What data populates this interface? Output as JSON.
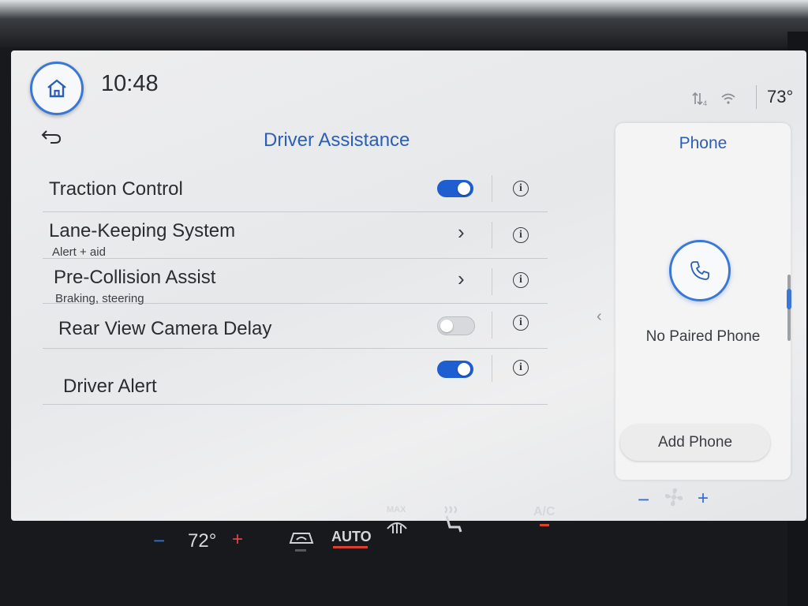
{
  "status_bar": {
    "time": "10:48",
    "outside_temp": "73°",
    "icons": [
      "home-icon",
      "data-signal-icon",
      "wifi-icon"
    ]
  },
  "settings": {
    "title": "Driver Assistance",
    "items": [
      {
        "label": "Traction Control",
        "sublabel": "",
        "control": "toggle",
        "on": true
      },
      {
        "label": "Lane-Keeping System",
        "sublabel": "Alert + aid",
        "control": "chevron",
        "chevron": "›"
      },
      {
        "label": "Pre-Collision Assist",
        "sublabel": "Braking, steering",
        "control": "chevron",
        "chevron": "›"
      },
      {
        "label": "Rear View Camera Delay",
        "sublabel": "",
        "control": "toggle",
        "on": false
      },
      {
        "label": "Driver Alert",
        "sublabel": "",
        "control": "toggle",
        "on": true
      }
    ],
    "info_glyph": "i"
  },
  "phone_panel": {
    "title": "Phone",
    "status": "No Paired Phone",
    "add_button": "Add Phone"
  },
  "climate": {
    "minus": "−",
    "plus": "+",
    "driver_temp": "72°",
    "auto_label": "AUTO",
    "max_label": "MAX",
    "ac_label": "A/C"
  },
  "colors": {
    "accent": "#2b5fb5",
    "toggle_on": "#1f5ed0",
    "indicator_red": "#d9412f"
  }
}
